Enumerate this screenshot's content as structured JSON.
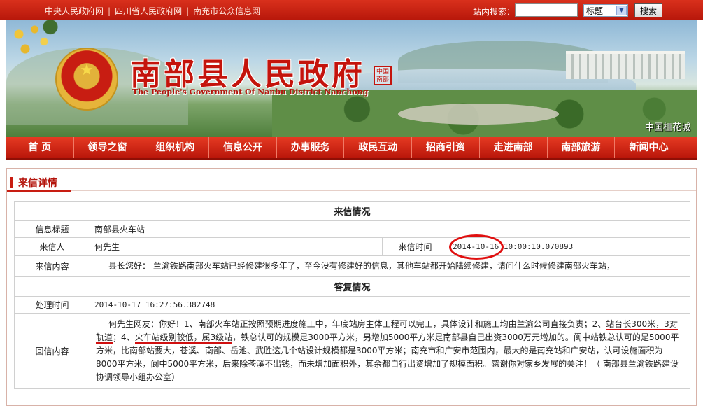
{
  "top": {
    "links": [
      "中央人民政府网",
      "四川省人民政府网",
      "南充市公众信息网"
    ],
    "search_label": "站内搜索：",
    "search_value": "",
    "search_select": "标题",
    "search_button": "搜索"
  },
  "banner": {
    "title": "南部县人民政府",
    "subtitle": "The People's Government Of Nanbu District Nanchong",
    "seal": "中国南部",
    "city": "中国桂花城"
  },
  "nav": [
    "首 页",
    "领导之窗",
    "组织机构",
    "信息公开",
    "办事服务",
    "政民互动",
    "招商引资",
    "走进南部",
    "南部旅游",
    "新闻中心"
  ],
  "panel": {
    "title": "来信详情"
  },
  "letter": {
    "section_title": "来信情况",
    "subject_label": "信息标题",
    "subject": "南部县火车站",
    "sender_label": "来信人",
    "sender": "何先生",
    "time_label": "来信时间",
    "time_date": "2014-10-16",
    "time_rest": " 10:00:10.070893",
    "content_label": "来信内容",
    "content": "县长您好： 兰渝铁路南部火车站已经修建很多年了，至今没有修建好的信息，其他车站都开始陆续修建，请问什么时候修建南部火车站，"
  },
  "reply": {
    "section_title": "答复情况",
    "time_label": "处理时间",
    "time": "2014-10-17 16:27:56.382748",
    "content_label": "回信内容",
    "part1": "何先生网友：你好！1、南部火车站正按照预期进度施工中，年底站房主体工程可以完工，具体设计和施工均由兰渝公司直接负责；2、",
    "u1": "站台长300米，3对轨道",
    "part2": "；4、",
    "u2": "火车站级别较低，属3级站",
    "part3": "，铁总认可的规模是3000平方米，另增加5000平方米是南部县自己出资3000万元增加的。阆中站铁总认可的是5000平方米，比南部站要大，苍溪、南部、岳池、武胜这几个站设计规模都是3000平方米；南充市和广安市范围内，最大的是南充站和广安站，认可设施面积为8000平方米，阆中5000平方米，后来除苍溪不出钱，而未增加面积外，其余都自行出资增加了规模面积。感谢你对家乡发展的关注！（ 南部县兰渝铁路建设协调领导小组办公室）"
  }
}
